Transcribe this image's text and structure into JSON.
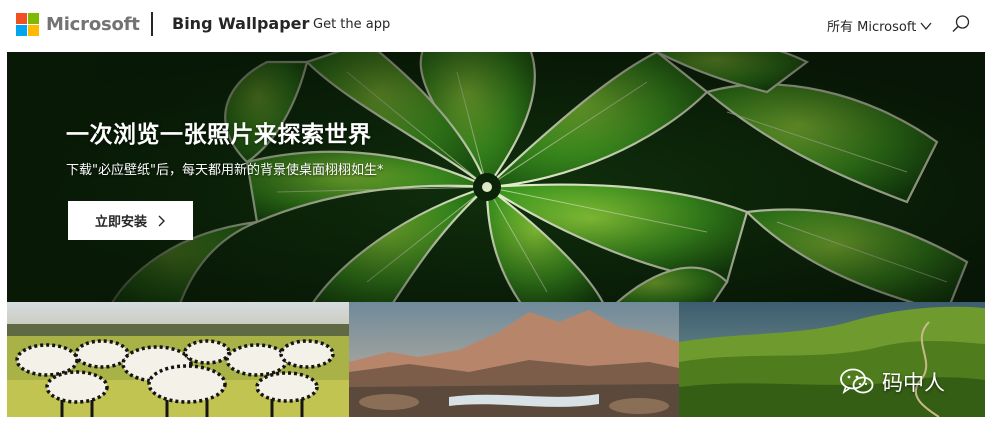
{
  "header": {
    "brand": "Microsoft",
    "product": "Bing Wallpaper",
    "get_app": "Get the app",
    "all_microsoft": "所有 Microsoft",
    "icons": {
      "logo": "microsoft-logo-icon",
      "chevron": "chevron-down-icon",
      "search": "search-icon"
    }
  },
  "hero": {
    "title": "一次浏览一张照片来探索世界",
    "subtitle": "下载\"必应壁纸\"后，每天都用新的背景使桌面栩栩如生*",
    "cta_label": "立即安装",
    "cta_icon": "chevron-right-icon"
  },
  "gallery": {
    "tiles": [
      "zebra-herd",
      "mountain-river",
      "green-hills"
    ]
  },
  "watermark": {
    "text": "码中人",
    "icon": "wechat-icon"
  },
  "colors": {
    "ms_red": "#f25022",
    "ms_green": "#7fba00",
    "ms_blue": "#00a4ef",
    "ms_yellow": "#ffb900",
    "text_dark": "#262626",
    "brand_gray": "#737373"
  }
}
